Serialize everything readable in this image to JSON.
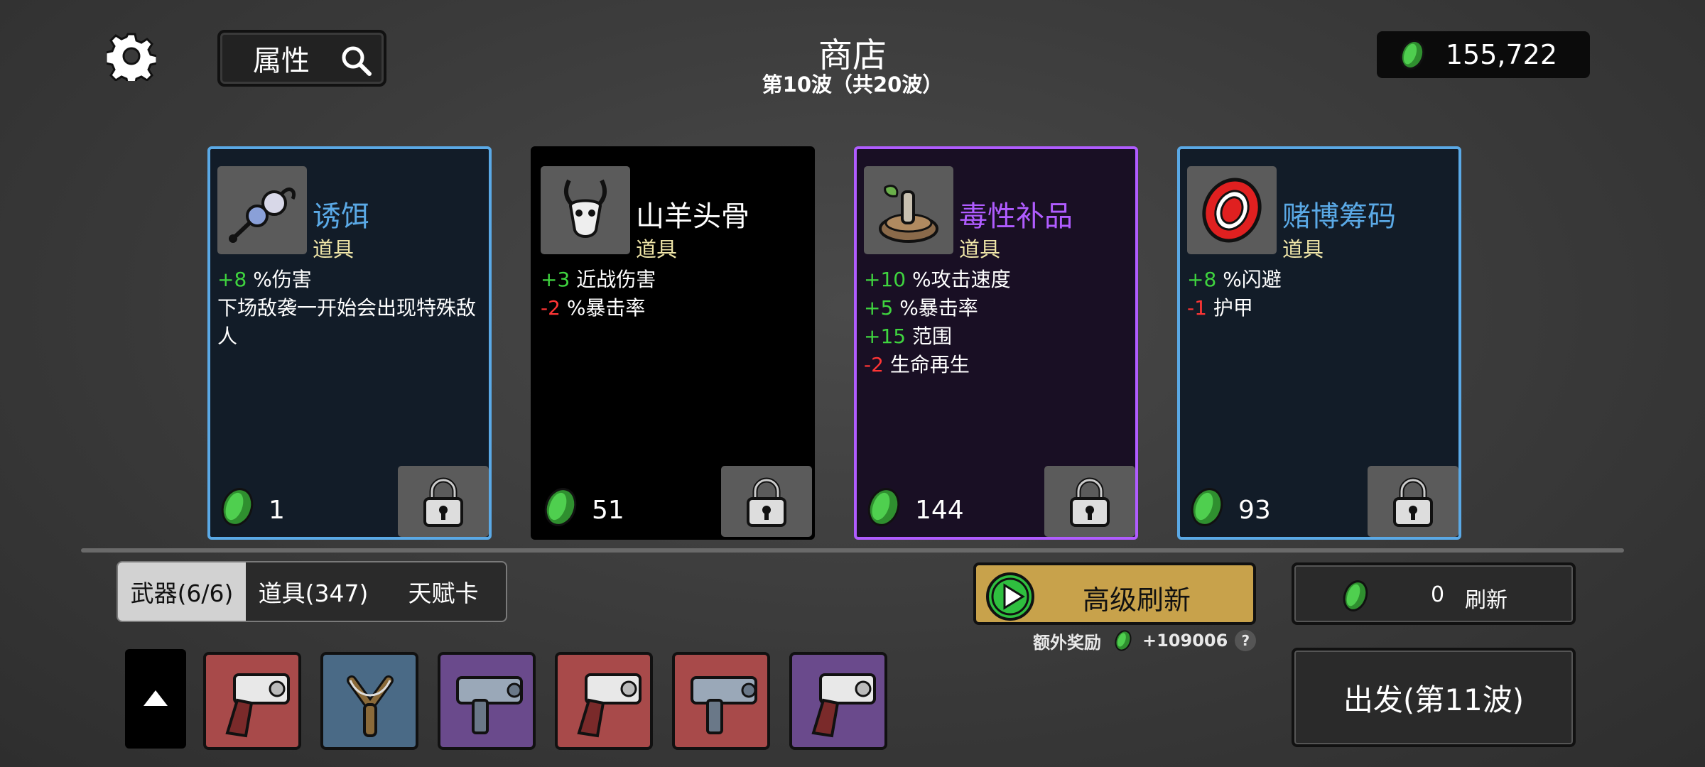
{
  "header": {
    "title": "商店",
    "subtitle": "第10波（共20波）",
    "search_label": "属性",
    "money": "155,722"
  },
  "colors": {
    "coin": "#3fb33f",
    "positive": "#3fd43f",
    "negative": "#ff3535",
    "tier_blue": "#5aa9e6",
    "tier_purple": "#b05cff",
    "gold_button": "#c8a24b"
  },
  "cards": [
    {
      "name": "诱饵",
      "name_color": "#5aa9e6",
      "kind": "道具",
      "stats": [
        {
          "value": "+8",
          "text": "%伤害"
        },
        {
          "value": "",
          "text": "下场敌袭一开始会出现特殊敌人"
        }
      ],
      "price": "1",
      "icon": "lure-icon"
    },
    {
      "name": "山羊头骨",
      "name_color": "#ffffff",
      "kind": "道具",
      "stats": [
        {
          "value": "+3",
          "text": "近战伤害"
        },
        {
          "value": "-2",
          "text": "%暴击率"
        }
      ],
      "price": "51",
      "icon": "goat-skull-icon"
    },
    {
      "name": "毒性补品",
      "name_color": "#b05cff",
      "kind": "道具",
      "stats": [
        {
          "value": "+10",
          "text": "%攻击速度"
        },
        {
          "value": "+5",
          "text": "%暴击率"
        },
        {
          "value": "+15",
          "text": "范围"
        },
        {
          "value": "-2",
          "text": "生命再生"
        }
      ],
      "price": "144",
      "icon": "toxic-supplement-icon"
    },
    {
      "name": "赌博筹码",
      "name_color": "#5aa9e6",
      "kind": "道具",
      "stats": [
        {
          "value": "+8",
          "text": "%闪避"
        },
        {
          "value": "-1",
          "text": "护甲"
        }
      ],
      "price": "93",
      "icon": "poker-chip-icon"
    }
  ],
  "tabs": [
    "武器(6/6)",
    "道具(347)",
    "天赋卡"
  ],
  "weapons": [
    {
      "icon": "revolver-icon",
      "tier": "red"
    },
    {
      "icon": "slingshot-icon",
      "tier": "blue"
    },
    {
      "icon": "smg-icon",
      "tier": "purple"
    },
    {
      "icon": "revolver-icon",
      "tier": "red"
    },
    {
      "icon": "smg-icon",
      "tier": "red"
    },
    {
      "icon": "revolver-icon",
      "tier": "purple"
    }
  ],
  "actions": {
    "advanced_refresh": "高级刷新",
    "bonus_label": "额外奖励",
    "bonus_value": "+109006",
    "help": "?",
    "refresh_cost": "0",
    "refresh_label": "刷新",
    "go_label": "出发(第11波)"
  }
}
